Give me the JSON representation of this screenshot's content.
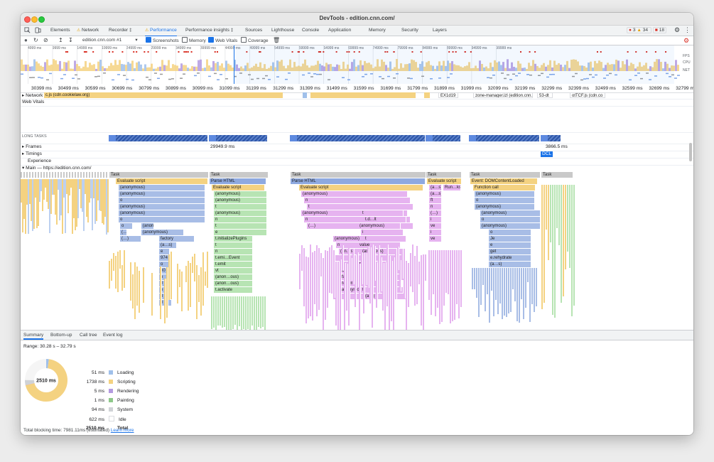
{
  "window": {
    "title": "DevTools - edition.cnn.com/"
  },
  "tabs": [
    {
      "label": "Elements",
      "warn": false,
      "active": false
    },
    {
      "label": "Network",
      "warn": true,
      "active": false
    },
    {
      "label": "Recorder ‡",
      "warn": false,
      "active": false
    },
    {
      "label": "Performance",
      "warn": true,
      "active": true
    },
    {
      "label": "Performance insights ‡",
      "warn": false,
      "active": false
    },
    {
      "label": "Sources",
      "warn": false,
      "active": false
    },
    {
      "label": "Lighthouse",
      "warn": false,
      "active": false
    },
    {
      "label": "Console",
      "warn": false,
      "active": false
    },
    {
      "label": "Application",
      "warn": false,
      "active": false
    },
    {
      "label": "Memory",
      "warn": false,
      "active": false
    },
    {
      "label": "Security",
      "warn": false,
      "active": false
    },
    {
      "label": "Layers",
      "warn": false,
      "active": false
    }
  ],
  "badges": {
    "errors": "3",
    "warnings": "34",
    "issues": "18"
  },
  "toolbar": {
    "recording": "edition.cnn.com #1",
    "screenshots": "Screenshots",
    "memory": "Memory",
    "web_vitals": "Web Vitals",
    "coverage": "Coverage"
  },
  "overview": {
    "ticks": [
      "4999 ms",
      "9999 ms",
      "14999 ms",
      "19999 ms",
      "24999 ms",
      "29999 ms",
      "34999 ms",
      "39999 ms",
      "44999 ms",
      "49999 ms",
      "54999 ms",
      "59999 ms",
      "64999 ms",
      "69999 ms",
      "74999 ms",
      "79999 ms",
      "84999 ms",
      "89999 ms",
      "94999 ms",
      "99999 ms"
    ],
    "labels": {
      "fps": "FPS",
      "cpu": "CPU",
      "net": "NET"
    }
  },
  "timeline_ticks": [
    "30399 ms",
    "30499 ms",
    "30599 ms",
    "30699 ms",
    "30799 ms",
    "30899 ms",
    "30999 ms",
    "31099 ms",
    "31199 ms",
    "31299 ms",
    "31399 ms",
    "31499 ms",
    "31599 ms",
    "31699 ms",
    "31799 ms",
    "31899 ms",
    "31999 ms",
    "32099 ms",
    "32199 ms",
    "32299 ms",
    "32399 ms",
    "32499 ms",
    "32599 ms",
    "32699 ms",
    "32799 ms"
  ],
  "tracks": {
    "network": "Network",
    "network_items": [
      "c.js (cdn.cookielaw.org)",
      "EX1d19",
      "zone-manager.izl (edition.cnn.com)",
      "53-dt",
      "otTCF.js (cdn.co"
    ],
    "web_vitals": "Web Vitals",
    "long_tasks": "LONG TASKS",
    "frames": "Frames",
    "frame_times": [
      "29949.9 ms",
      "3866.5 ms"
    ],
    "timings": "Timings",
    "dcl": "DCL",
    "experience": "Experience",
    "main": "Main — https://edition.cnn.com/"
  },
  "flame": {
    "task": "Task",
    "evaluate_script": "Evaluate script",
    "parse_html": "Parse HTML",
    "event_dcl": "Event: DOMContentLoaded",
    "function_call": "Function call",
    "col1": [
      "(anonymous)",
      "(anonymous)",
      "o",
      "(anonymous)",
      "(anonymous)",
      "o"
    ],
    "col1b": [
      "(…",
      "(anonymous)",
      "o",
      "(anonymous)",
      "(…",
      "(anonymous)",
      "(…)",
      "factory",
      "(a…s)",
      "e",
      "974",
      "o",
      "80",
      "o",
      "0",
      "o",
      "3",
      "0"
    ],
    "col2": [
      "Evaluate script",
      "(anonymous)",
      "(anonymous)",
      "t",
      "(anonymous)",
      "n",
      "t",
      "e",
      "t.initializePlugins",
      "t",
      "n",
      "t.emi…Event",
      "t.emit",
      "vt",
      "(anon…ous)",
      "(anon…ous)",
      "t.activate"
    ],
    "col3": [
      "(anonymous)",
      "n",
      "t",
      "(anonymous)",
      "n",
      "(…)",
      "(anonymous)",
      "n",
      "(an…s)",
      "i",
      "t",
      "(anonymous)",
      "t.default",
      "(anonymous)",
      "(anonymous)",
      "r",
      "t",
      "t.d…lt",
      "(anonymous)",
      "i",
      "t",
      "value",
      "(ano…ous)",
      "e",
      "t",
      "(a…)",
      "(a…s)",
      "(a…)",
      "t",
      "(a…)"
    ],
    "col4": [
      "(a…s)",
      "Run…ks",
      "(a…s)",
      "ft",
      "n",
      "(…)",
      "i",
      "ve",
      "i",
      "ve"
    ],
    "col5": [
      "(anonymous)",
      "o",
      "(anonymous)",
      "(anonymous)",
      "o",
      "(anonymous)",
      "o",
      "Je",
      "e",
      "get",
      "e.rehydrate",
      "(a…s)"
    ]
  },
  "bottom": {
    "tabs": [
      "Summary",
      "Bottom-up",
      "Call tree",
      "Event log"
    ],
    "range": "Range: 30.28 s – 32.79 s",
    "total_center": "2510 ms",
    "legend": [
      {
        "value": "51 ms",
        "label": "Loading",
        "color": "#a0c0ea"
      },
      {
        "value": "1738 ms",
        "label": "Scripting",
        "color": "#f4d281"
      },
      {
        "value": "5 ms",
        "label": "Rendering",
        "color": "#b39ae0"
      },
      {
        "value": "1 ms",
        "label": "Painting",
        "color": "#8ec88a"
      },
      {
        "value": "94 ms",
        "label": "System",
        "color": "#cfd2d6"
      },
      {
        "value": "622 ms",
        "label": "Idle",
        "color": "#ffffff"
      },
      {
        "value": "2510 ms",
        "label": "Total",
        "color": ""
      }
    ],
    "footer": "Total blocking time: 7981.11ms (estimated)",
    "footer_link": "Learn more"
  },
  "colors": {
    "accent": "#1a73e8",
    "scripting": "#f4d281",
    "loading": "#a0c0ea",
    "parse": "#c6cff5",
    "purple": "#e6b3f0",
    "green": "#b7e4b3",
    "task": "#c9c9c9",
    "longtask": "#2d55a8"
  }
}
